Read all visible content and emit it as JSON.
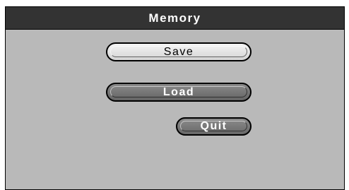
{
  "dialog": {
    "title": "Memory"
  },
  "buttons": {
    "save_label": "Save",
    "load_label": "Load",
    "quit_label": "Quit"
  },
  "colors": {
    "titlebar": "#333333",
    "panel": "#b9b9b9",
    "save_button": "#e4e4e4",
    "dark_button": "#777777"
  }
}
